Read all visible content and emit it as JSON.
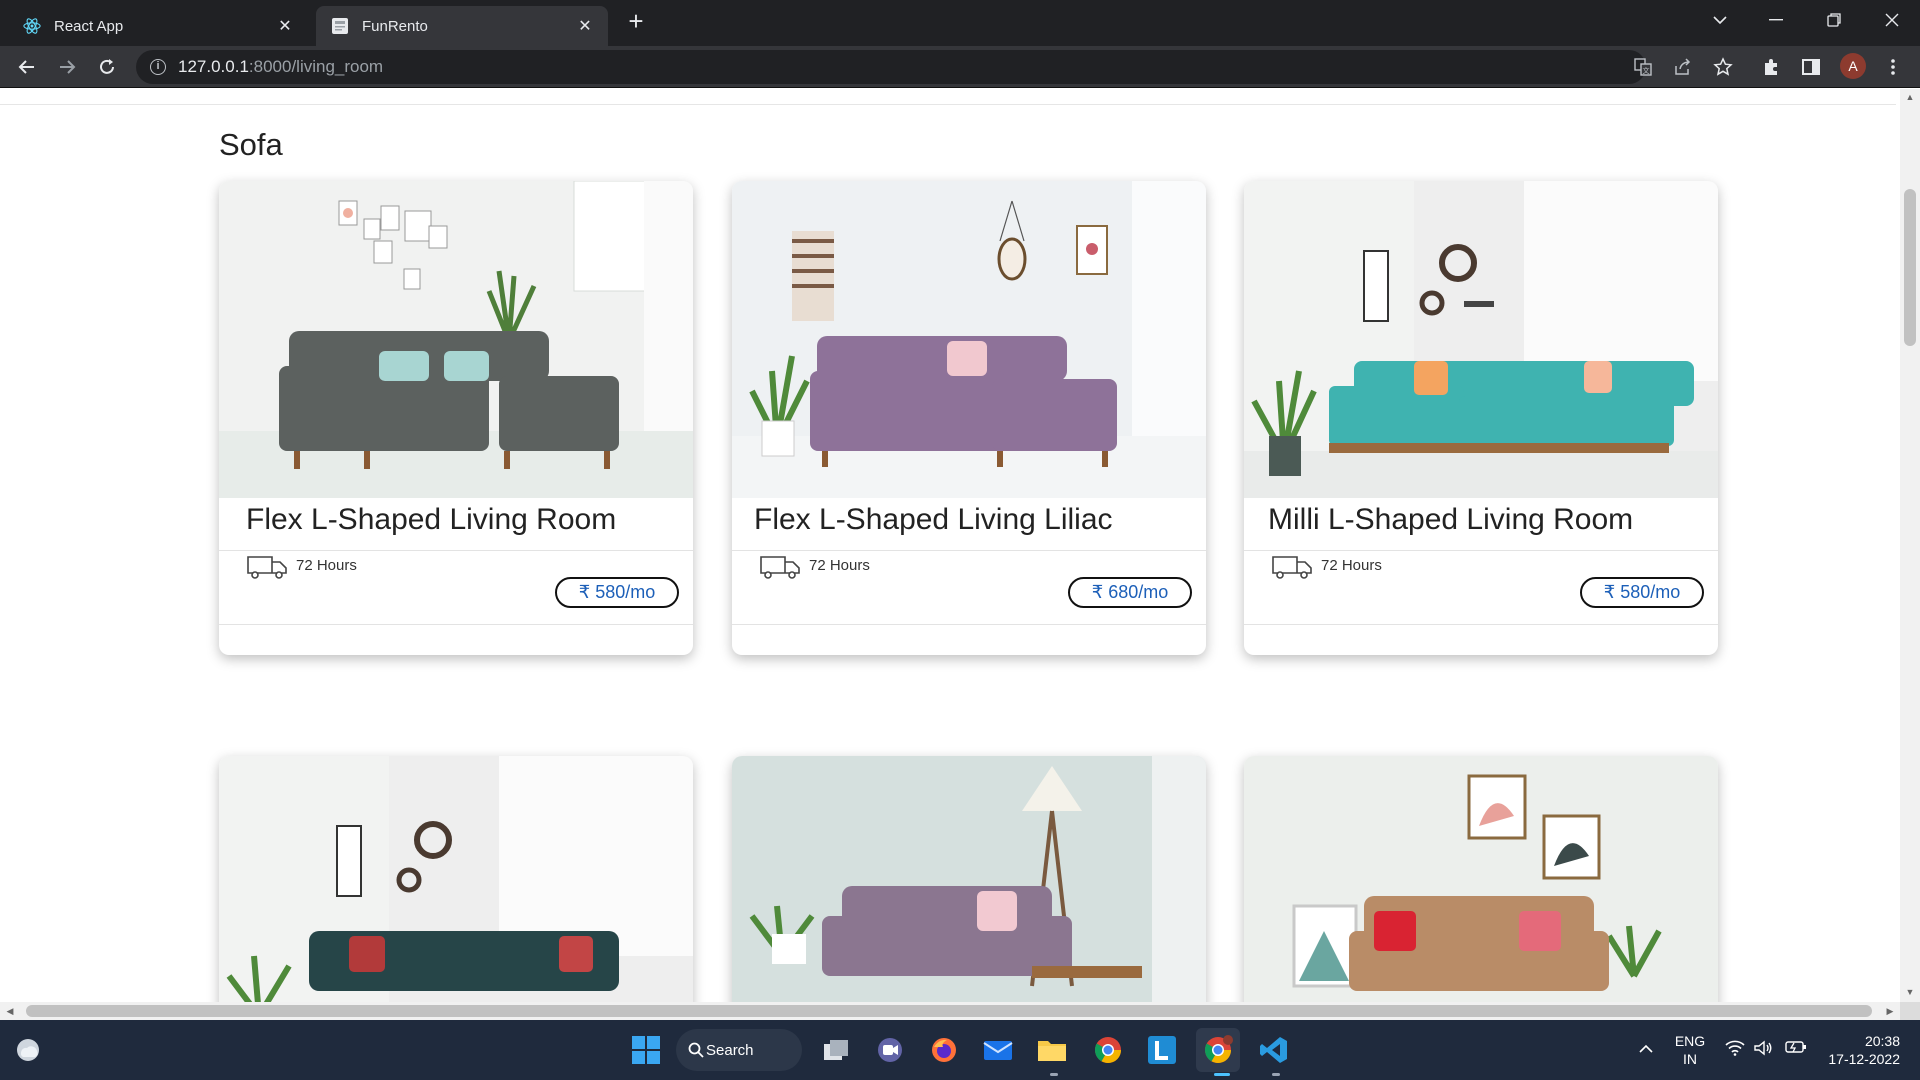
{
  "browser": {
    "tabs": [
      {
        "title": "React App",
        "favicon": "react-logo-icon",
        "active": false
      },
      {
        "title": "FunRento",
        "favicon": "page-icon",
        "active": true
      }
    ],
    "new_tab_label": "+",
    "address": {
      "host": "127.0.0.1",
      "path": ":8000/living_room"
    },
    "profile_initial": "A"
  },
  "page": {
    "section_title": "Sofa",
    "products": [
      {
        "name": "Flex L-Shaped Living Room",
        "delivery": "72 Hours",
        "price": "₹ 580/mo",
        "sofa_color": "#5c615f"
      },
      {
        "name": "Flex L-Shaped Living Liliac",
        "delivery": "72 Hours",
        "price": "₹ 680/mo",
        "sofa_color": "#8e7299"
      },
      {
        "name": "Milli L-Shaped Living Room",
        "delivery": "72 Hours",
        "price": "₹ 580/mo",
        "sofa_color": "#3fb3b0"
      },
      {
        "sofa_color": "#264548"
      },
      {
        "sofa_color": "#8b7690"
      },
      {
        "sofa_color": "#b98c67"
      }
    ]
  },
  "taskbar": {
    "search_label": "Search",
    "language": "ENG",
    "region": "IN",
    "time": "20:38",
    "date": "17-12-2022"
  },
  "colors": {
    "price_text": "#1c5fb8",
    "chrome_dark": "#202124",
    "chrome_toolbar": "#35363a",
    "taskbar_bg": "#1f2a3d"
  }
}
